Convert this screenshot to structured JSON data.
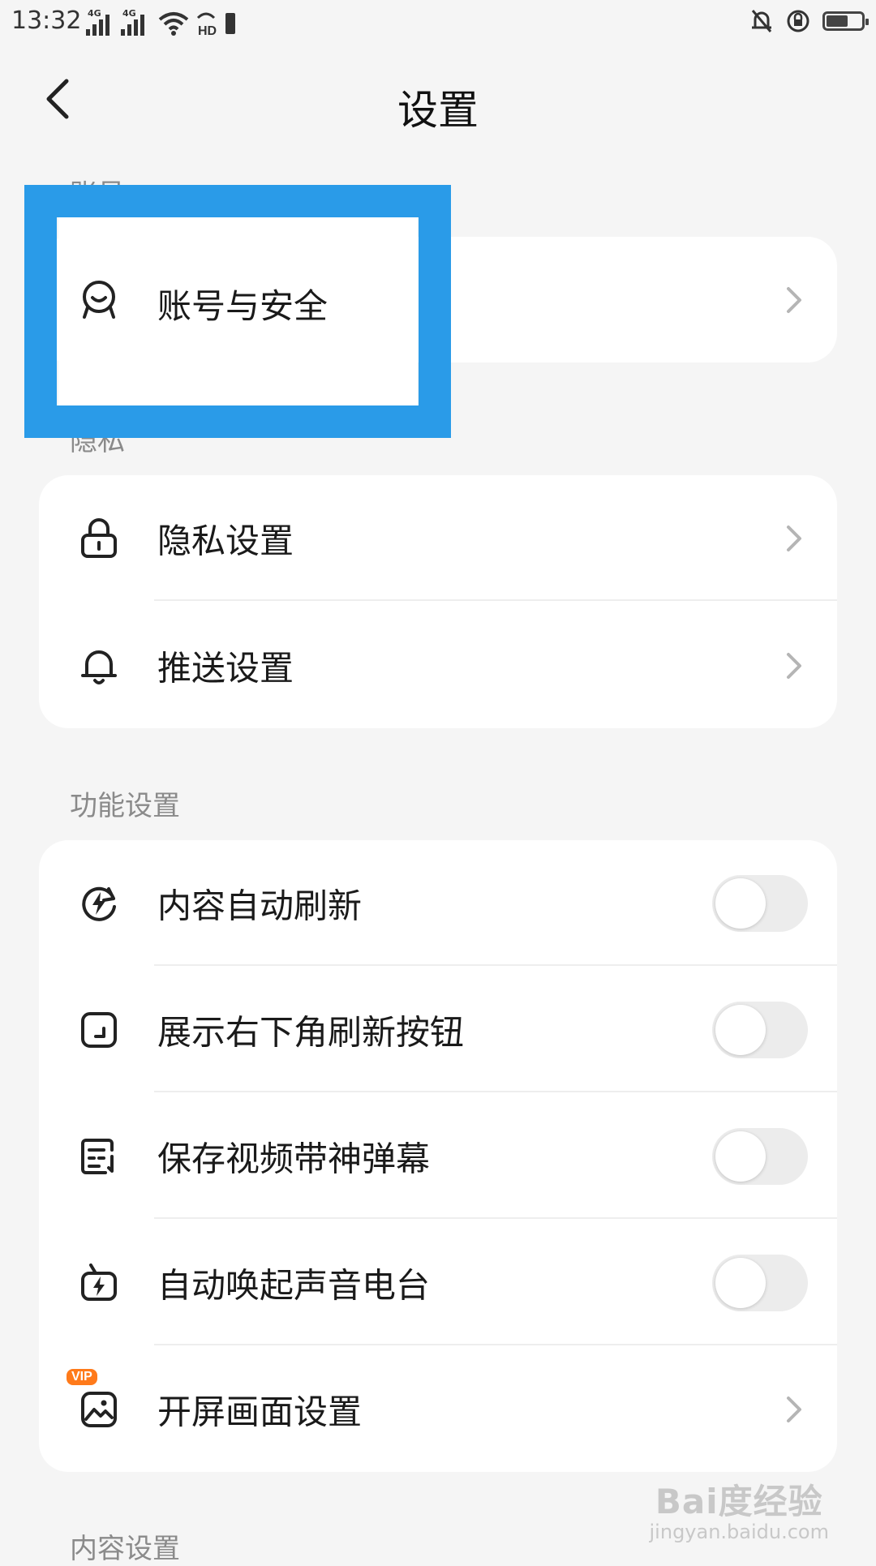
{
  "status_bar": {
    "time": "13:32",
    "sim1": "4G",
    "sim2": "4G",
    "hd_label": "HD",
    "battery_level": 0.55
  },
  "header": {
    "title": "设置",
    "back_icon": "chevron-left-icon"
  },
  "sections": {
    "account": {
      "label": "账号"
    },
    "privacy": {
      "label": "隐私"
    },
    "features": {
      "label": "功能设置"
    },
    "content": {
      "label": "内容设置"
    }
  },
  "account_card": {
    "items": [
      {
        "label": "账号与安全",
        "icon": "account-shield-icon",
        "control": "chevron"
      }
    ]
  },
  "privacy_card": {
    "items": [
      {
        "label": "隐私设置",
        "icon": "lock-icon",
        "control": "chevron"
      },
      {
        "label": "推送设置",
        "icon": "bell-icon",
        "control": "chevron"
      }
    ]
  },
  "feature_card": {
    "items": [
      {
        "label": "内容自动刷新",
        "icon": "auto-refresh-icon",
        "control": "toggle",
        "on": false
      },
      {
        "label": "展示右下角刷新按钮",
        "icon": "corner-refresh-icon",
        "control": "toggle",
        "on": false
      },
      {
        "label": "保存视频带神弹幕",
        "icon": "danmaku-icon",
        "control": "toggle",
        "on": false
      },
      {
        "label": "自动唤起声音电台",
        "icon": "radio-icon",
        "control": "toggle",
        "on": false
      },
      {
        "label": "开屏画面设置",
        "icon": "splash-image-icon",
        "badge": "VIP",
        "control": "chevron"
      }
    ]
  },
  "colors": {
    "background": "#f5f5f5",
    "card": "#ffffff",
    "highlight": "#2a9be8",
    "section_label": "#8a8a8a",
    "vip_badge": "#ff7a1a"
  },
  "watermark": {
    "logo": "Bai度经验",
    "url": "jingyan.baidu.com"
  }
}
